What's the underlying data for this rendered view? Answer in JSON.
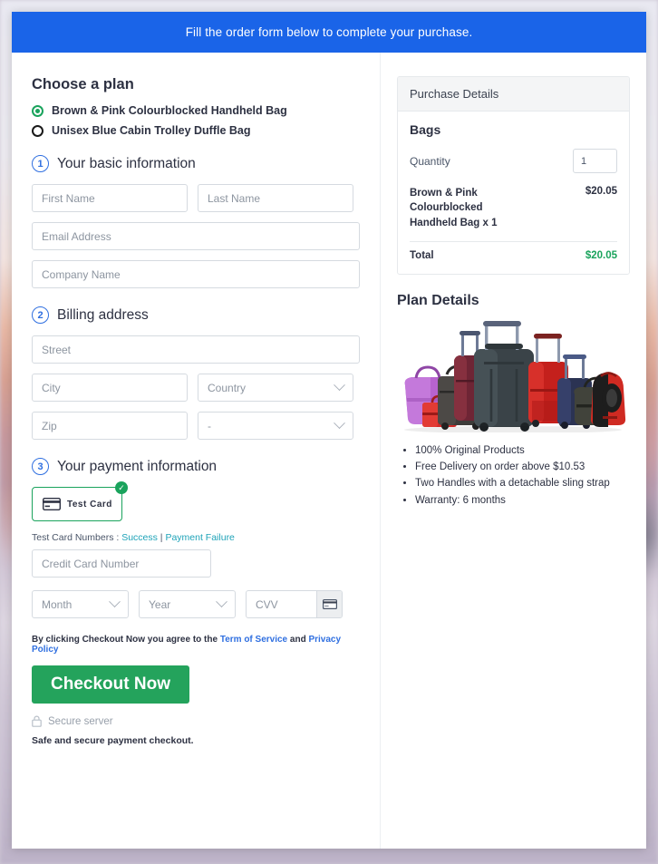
{
  "banner": {
    "text": "Fill the order form below to complete your purchase."
  },
  "plan": {
    "heading": "Choose a plan",
    "options": [
      {
        "label": "Brown & Pink Colourblocked Handheld Bag",
        "selected": true
      },
      {
        "label": "Unisex Blue Cabin Trolley Duffle Bag",
        "selected": false
      }
    ]
  },
  "steps": {
    "basic": {
      "number": "1",
      "title": "Your basic information"
    },
    "billing": {
      "number": "2",
      "title": "Billing address"
    },
    "payment": {
      "number": "3",
      "title": "Your payment information"
    }
  },
  "fields": {
    "first_name": "First Name",
    "last_name": "Last Name",
    "email": "Email Address",
    "company": "Company Name",
    "street": "Street",
    "city": "City",
    "country": "Country",
    "zip": "Zip",
    "state": "-",
    "card_number": "Credit Card Number",
    "month": "Month",
    "year": "Year",
    "cvv": "CVV"
  },
  "payment": {
    "test_card_label": "Test Card",
    "note_prefix": "Test Card Numbers : ",
    "link_success": "Success",
    "note_sep": " | ",
    "link_failure": "Payment Failure"
  },
  "terms": {
    "prefix": "By clicking Checkout Now you agree to the ",
    "tos": "Term of Service",
    "middle": " and ",
    "privacy": "Privacy Policy"
  },
  "checkout": {
    "button_label": "Checkout Now",
    "secure_label": "Secure server",
    "safe_note": "Safe and secure payment checkout."
  },
  "purchase_details": {
    "header": "Purchase Details",
    "title": "Bags",
    "quantity_label": "Quantity",
    "quantity_value": "1",
    "item_name": "Brown & Pink Colourblocked Handheld Bag x 1",
    "item_price": "$20.05",
    "total_label": "Total",
    "total_value": "$20.05"
  },
  "plan_details": {
    "title": "Plan Details",
    "features": [
      "100% Original Products",
      "Free Delivery on order above $10.53",
      "Two Handles with a detachable sling strap",
      "Warranty: 6 months"
    ]
  },
  "colors": {
    "banner_blue": "#1a64e8",
    "accent_green": "#1aa35c",
    "checkout_green": "#24a35c",
    "link_blue": "#2f6fe0",
    "link_teal": "#1ea3b8"
  }
}
